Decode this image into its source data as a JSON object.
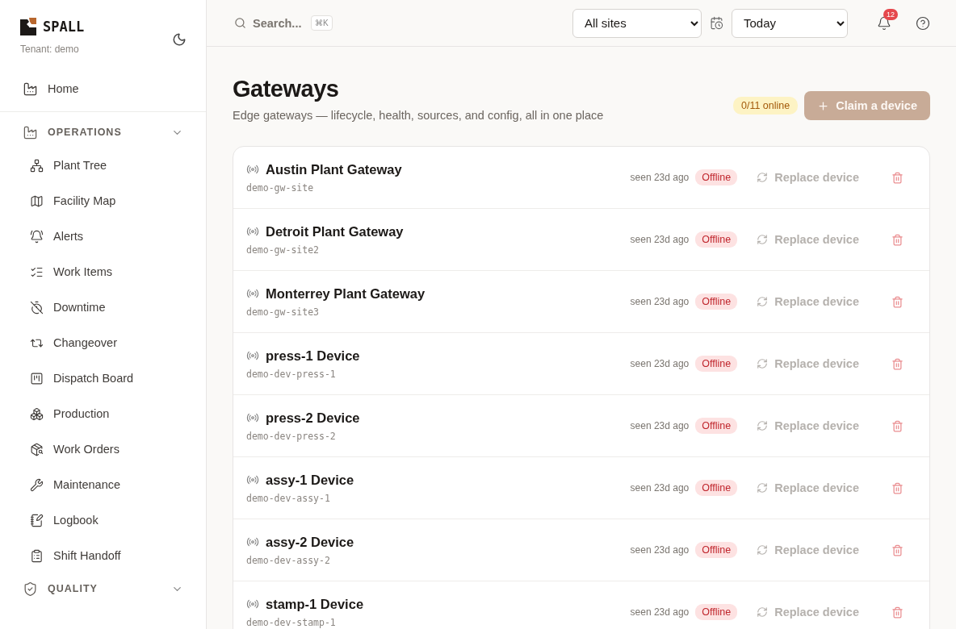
{
  "brand": {
    "logo": "SPALL",
    "tenant": "Tenant: demo"
  },
  "sidebar": {
    "home": "Home",
    "sections": [
      {
        "title": "OPERATIONS",
        "expanded": true,
        "items": [
          "Plant Tree",
          "Facility Map",
          "Alerts",
          "Work Items",
          "Downtime",
          "Changeover",
          "Dispatch Board",
          "Production",
          "Work Orders",
          "Maintenance",
          "Logbook",
          "Shift Handoff"
        ]
      },
      {
        "title": "QUALITY",
        "expanded": true
      }
    ]
  },
  "topbar": {
    "search": {
      "placeholder": "Search...",
      "shortcut": "⌘K"
    },
    "site_select": "All sites",
    "range_select": "Today",
    "notifications": "12"
  },
  "page": {
    "title": "Gateways",
    "subtitle": "Edge gateways — lifecycle, health, sources, and config, all in one place",
    "online_badge": "0/11 online",
    "claim_button": "Claim a device"
  },
  "gateways": [
    {
      "name": "Austin Plant Gateway",
      "id": "demo-gw-site",
      "seen": "seen 23d ago",
      "status": "Offline",
      "action": "Replace device"
    },
    {
      "name": "Detroit Plant Gateway",
      "id": "demo-gw-site2",
      "seen": "seen 23d ago",
      "status": "Offline",
      "action": "Replace device"
    },
    {
      "name": "Monterrey Plant Gateway",
      "id": "demo-gw-site3",
      "seen": "seen 23d ago",
      "status": "Offline",
      "action": "Replace device"
    },
    {
      "name": "press-1 Device",
      "id": "demo-dev-press-1",
      "seen": "seen 23d ago",
      "status": "Offline",
      "action": "Replace device"
    },
    {
      "name": "press-2 Device",
      "id": "demo-dev-press-2",
      "seen": "seen 23d ago",
      "status": "Offline",
      "action": "Replace device"
    },
    {
      "name": "assy-1 Device",
      "id": "demo-dev-assy-1",
      "seen": "seen 23d ago",
      "status": "Offline",
      "action": "Replace device"
    },
    {
      "name": "assy-2 Device",
      "id": "demo-dev-assy-2",
      "seen": "seen 23d ago",
      "status": "Offline",
      "action": "Replace device"
    },
    {
      "name": "stamp-1 Device",
      "id": "demo-dev-stamp-1",
      "seen": "seen 23d ago",
      "status": "Offline",
      "action": "Replace device"
    }
  ]
}
